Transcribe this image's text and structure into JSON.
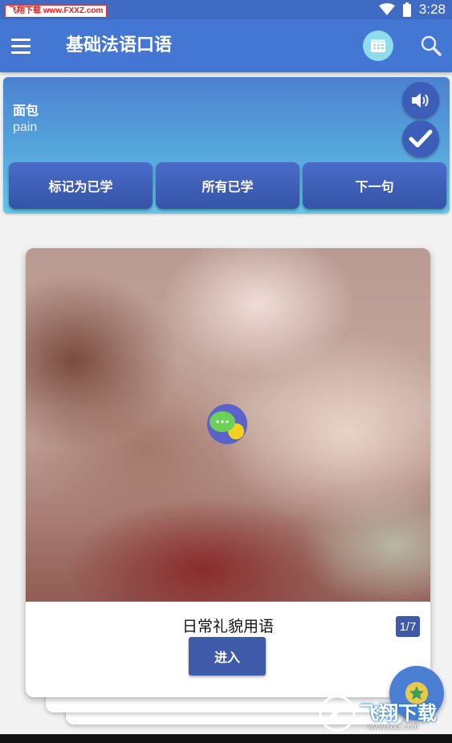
{
  "status_bar": {
    "watermark": "飞翔下载 www.FXXZ.com",
    "time": "3:28"
  },
  "app_bar": {
    "title": "基础法语口语",
    "icons": [
      "menu-icon",
      "calendar-icon",
      "search-icon"
    ]
  },
  "word_card": {
    "chinese": "面包",
    "french": "pain",
    "icons": [
      "speaker-icon",
      "check-icon"
    ],
    "actions": [
      {
        "label": "标记为已学"
      },
      {
        "label": "所有已学"
      },
      {
        "label": "下一句"
      }
    ]
  },
  "category_card": {
    "title": "日常礼貌用语",
    "page": "1/7",
    "enter_label": "进入",
    "icon": "chat-bubbles-icon"
  },
  "fab": {
    "icon": "star-icon"
  },
  "watermark_logo": {
    "brand": "飞翔下载",
    "url": "www.fxxz.com"
  },
  "colors": {
    "primary": "#4477d4",
    "accent": "#3f5aa9",
    "card_gradient_top": "#4c81d0",
    "card_gradient_bottom": "#64c6e8"
  }
}
